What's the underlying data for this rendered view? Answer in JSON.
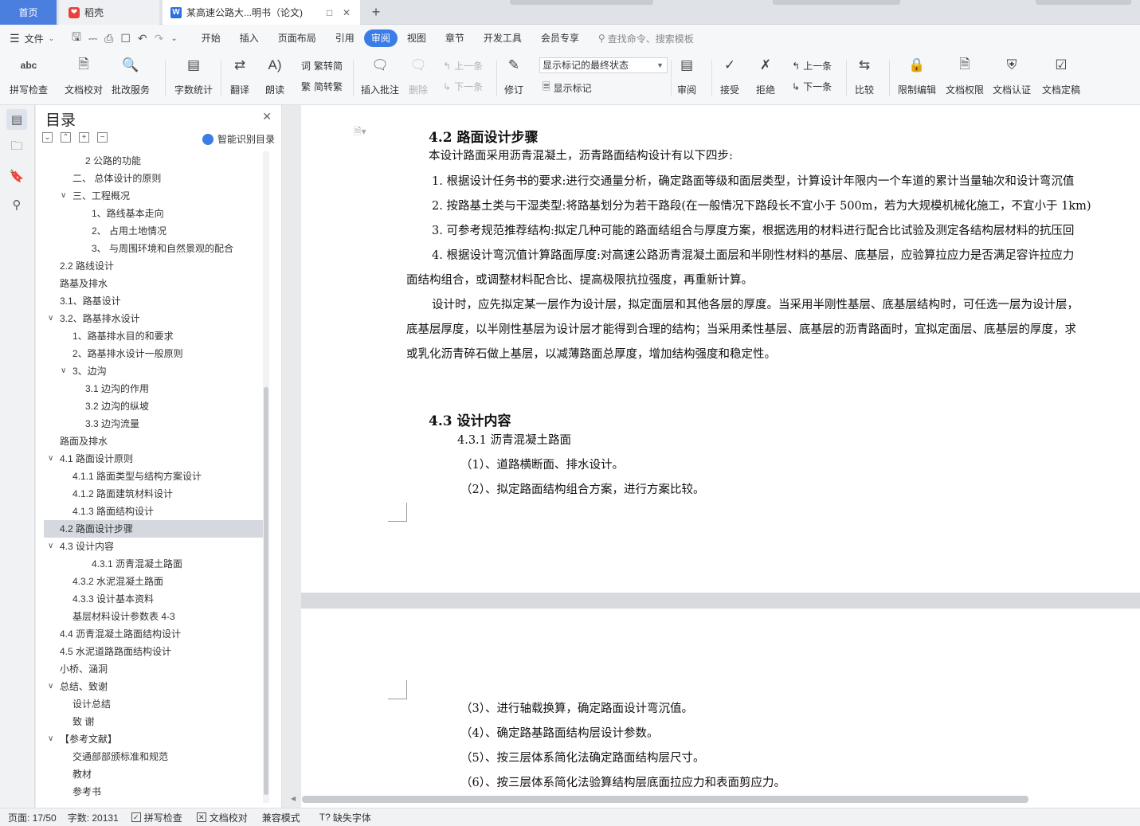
{
  "tabs": {
    "home": "首页",
    "daoke": "稻壳",
    "doc": "某高速公路大...明书（论文)",
    "add": "+"
  },
  "menu": {
    "file": "文件",
    "items": [
      "开始",
      "插入",
      "页面布局",
      "引用",
      "审阅",
      "视图",
      "章节",
      "开发工具",
      "会员专享"
    ],
    "search": "查找命令、搜索模板"
  },
  "ribbon": {
    "spell": "拼写检查",
    "doccheck": "文档校对",
    "approve": "批改服务",
    "wordcount": "字数统计",
    "translate": "翻译",
    "read": "朗读",
    "trad": "繁转简",
    "simp": "简转繁",
    "insert_comment": "插入批注",
    "delete": "删除",
    "prev_c": "上一条",
    "next_c": "下一条",
    "revise": "修订",
    "markup_state": "显示标记的最终状态",
    "show_markup": "显示标记",
    "review": "审阅",
    "accept": "接受",
    "reject": "拒绝",
    "prev": "上一条",
    "next": "下一条",
    "compare": "比较",
    "restrict": "限制编辑",
    "perm": "文档权限",
    "cert": "文档认证",
    "final": "文档定稿"
  },
  "toc": {
    "title": "目录",
    "smart": "智能识别目录",
    "items": [
      {
        "text": "2 公路的功能",
        "indent": 3,
        "arrow": ""
      },
      {
        "text": "二、 总体设计的原则",
        "indent": 2,
        "arrow": ""
      },
      {
        "text": "三、工程概况",
        "indent": 2,
        "arrow": "v"
      },
      {
        "text": "1、路线基本走向",
        "indent": 4,
        "arrow": ""
      },
      {
        "text": "2、  占用土地情况",
        "indent": 4,
        "arrow": ""
      },
      {
        "text": "3、  与周围环境和自然景观的配合",
        "indent": 4,
        "arrow": ""
      },
      {
        "text": "2.2 路线设计",
        "indent": 1,
        "arrow": ""
      },
      {
        "text": "路基及排水",
        "indent": 1,
        "arrow": ""
      },
      {
        "text": "3.1、路基设计",
        "indent": 1,
        "arrow": ""
      },
      {
        "text": "3.2、路基排水设计",
        "indent": 1,
        "arrow": "v"
      },
      {
        "text": "1、路基排水目的和要求",
        "indent": 2,
        "arrow": ""
      },
      {
        "text": "2、路基排水设计一般原则",
        "indent": 2,
        "arrow": ""
      },
      {
        "text": "3、边沟",
        "indent": 2,
        "arrow": "v"
      },
      {
        "text": "3.1 边沟的作用",
        "indent": 3,
        "arrow": ""
      },
      {
        "text": "3.2 边沟的纵坡",
        "indent": 3,
        "arrow": ""
      },
      {
        "text": "3.3 边沟流量",
        "indent": 3,
        "arrow": ""
      },
      {
        "text": "路面及排水",
        "indent": 1,
        "arrow": ""
      },
      {
        "text": "4.1  路面设计原则",
        "indent": 1,
        "arrow": "v"
      },
      {
        "text": "4.1.1 路面类型与结构方案设计",
        "indent": 2,
        "arrow": ""
      },
      {
        "text": "4.1.2 路面建筑材料设计",
        "indent": 2,
        "arrow": ""
      },
      {
        "text": "4.1.3  路面结构设计",
        "indent": 2,
        "arrow": ""
      },
      {
        "text": "4.2  路面设计步骤",
        "indent": 1,
        "arrow": "",
        "selected": true
      },
      {
        "text": "4.3 设计内容",
        "indent": 1,
        "arrow": "v"
      },
      {
        "text": "4.3.1 沥青混凝土路面",
        "indent": 4,
        "arrow": ""
      },
      {
        "text": "4.3.2  水泥混凝土路面",
        "indent": 2,
        "arrow": ""
      },
      {
        "text": "4.3.3 设计基本资料",
        "indent": 2,
        "arrow": ""
      },
      {
        "text": "基层材料设计参数表 4-3",
        "indent": 2,
        "arrow": ""
      },
      {
        "text": "4.4  沥青混凝土路面结构设计",
        "indent": 1,
        "arrow": ""
      },
      {
        "text": "4.5 水泥道路路面结构设计",
        "indent": 1,
        "arrow": ""
      },
      {
        "text": "小桥、涵洞",
        "indent": 1,
        "arrow": ""
      },
      {
        "text": "总结、致谢",
        "indent": 1,
        "arrow": "v"
      },
      {
        "text": "设计总结",
        "indent": 2,
        "arrow": ""
      },
      {
        "text": "致   谢",
        "indent": 2,
        "arrow": ""
      },
      {
        "text": "【参考文献】",
        "indent": 1,
        "arrow": "v"
      },
      {
        "text": "交通部部颁标准和规范",
        "indent": 2,
        "arrow": ""
      },
      {
        "text": "教材",
        "indent": 2,
        "arrow": ""
      },
      {
        "text": "参考书",
        "indent": 2,
        "arrow": ""
      }
    ]
  },
  "doc": {
    "h42": "4.2  路面设计步骤",
    "p1": "本设计路面采用沥青混凝土，沥青路面结构设计有以下四步:",
    "p2": "1. 根据设计任务书的要求:进行交通量分析，确定路面等级和面层类型，计算设计年限内一个车道的累计当量轴次和设计弯沉值",
    "p3": "2. 按路基土类与干湿类型:将路基划分为若干路段(在一般情况下路段长不宜小于 500m，若为大规模机械化施工，不宜小于 1km)",
    "p4": "3. 可参考规范推荐结构:拟定几种可能的路面结组合与厚度方案，根据选用的材料进行配合比试验及测定各结构层材料的抗压回",
    "p5": "4. 根据设计弯沉值计算路面厚度:对高速公路沥青混凝土面层和半刚性材料的基层、底基层，应验算拉应力是否满足容许拉应力",
    "p6": "面结构组合，或调整材料配合比、提高极限抗拉强度，再重新计算。",
    "p7": "设计时，应先拟定某一层作为设计层，拟定面层和其他各层的厚度。当采用半刚性基层、底基层结构时，可任选一层为设计层，",
    "p8": "底基层厚度，以半刚性基层为设计层才能得到合理的结构；当采用柔性基层、底基层的沥青路面时，宜拟定面层、底基层的厚度，求",
    "p9": "或乳化沥青碎石做上基层，以减薄路面总厚度，增加结构强度和稳定性。",
    "h43": "4.3 设计内容",
    "h431": "4.3.1 沥青混凝土路面",
    "l1": "（1）、道路横断面、排水设计。",
    "l2": "（2）、拟定路面结构组合方案，进行方案比较。",
    "l3": "（3）、进行轴载换算，确定路面设计弯沉值。",
    "l4": "（4）、确定路基路面结构层设计参数。",
    "l5": "（5）、按三层体系简化法确定路面结构层尺寸。",
    "l6": "（6）、按三层体系简化法验算结构层底面拉应力和表面剪应力。"
  },
  "status": {
    "page": "页面: 17/50",
    "words": "字数: 20131",
    "spell": "拼写检查",
    "check": "文档校对",
    "compat": "兼容模式",
    "font": "缺失字体"
  },
  "colors": {
    "accent": "#3b7ce6",
    "home_tab": "#4a7fe0"
  }
}
